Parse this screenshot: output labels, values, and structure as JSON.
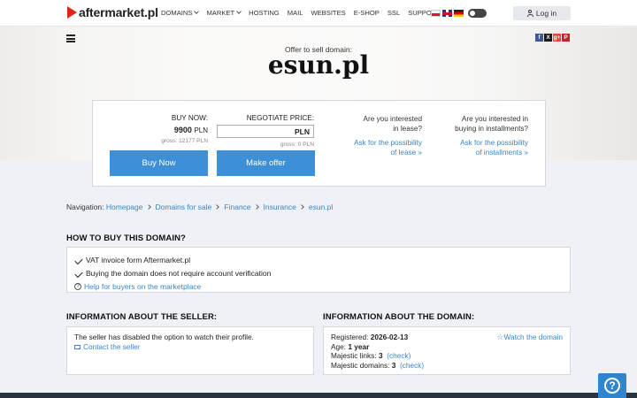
{
  "header": {
    "logo_text": "aftermarket.pl",
    "nav": [
      {
        "label": "DOMAINS",
        "dropdown": true
      },
      {
        "label": "MARKET",
        "dropdown": true
      },
      {
        "label": "HOSTING",
        "dropdown": false
      },
      {
        "label": "MAIL",
        "dropdown": false
      },
      {
        "label": "WEBSITES",
        "dropdown": false
      },
      {
        "label": "E-SHOP",
        "dropdown": false
      },
      {
        "label": "SSL",
        "dropdown": false
      },
      {
        "label": "SUPPORT",
        "dropdown": true
      }
    ],
    "login_label": "Log in"
  },
  "hero": {
    "offer_label": "Offer to sell domain:",
    "domain": "esun.pl",
    "social": [
      "f",
      "X",
      "g+",
      "P"
    ]
  },
  "offer": {
    "buy_now_label": "BUY NOW:",
    "buy_now_price": "9900",
    "currency": "PLN",
    "buy_now_gross": "gross: 12177 PLN",
    "negotiate_label": "NEGOTIATE PRICE:",
    "negotiate_currency": "PLN",
    "negotiate_gross": "gross: 0 PLN",
    "buy_button": "Buy Now",
    "make_offer_button": "Make offer",
    "lease_question_1": "Are you interested",
    "lease_question_2": "in lease?",
    "lease_link_1": "Ask for the possibility",
    "lease_link_2": "of lease »",
    "install_question_1": "Are you interested in",
    "install_question_2": "buying in installments?",
    "install_link_1": "Ask for the possibility",
    "install_link_2": "of installments »"
  },
  "breadcrumb": {
    "prefix": "Navigation:",
    "items": [
      "Homepage",
      "Domains for sale",
      "Finance",
      "Insurance",
      "esun.pl"
    ]
  },
  "how_to_buy": {
    "title": "HOW TO BUY THIS DOMAIN?",
    "items": [
      "VAT invoice form Aftermarket.pl",
      "Buying the domain does not require account verification"
    ],
    "help_link": "Help for buyers on the marketplace"
  },
  "seller": {
    "title": "INFORMATION ABOUT THE SELLER:",
    "text": "The seller has disabled the option to watch their profile.",
    "contact_link": "Contact the seller"
  },
  "domain_info": {
    "title": "INFORMATION ABOUT THE DOMAIN:",
    "registered_label": "Registered:",
    "registered_value": "2026-02-13",
    "age_label": "Age:",
    "age_value": "1 year",
    "links_label": "Majestic links:",
    "links_value": "3",
    "domains_label": "Majestic domains:",
    "domains_value": "3",
    "check_label": "(check)",
    "watch_label": "Watch the domain"
  },
  "help_icon": "?"
}
